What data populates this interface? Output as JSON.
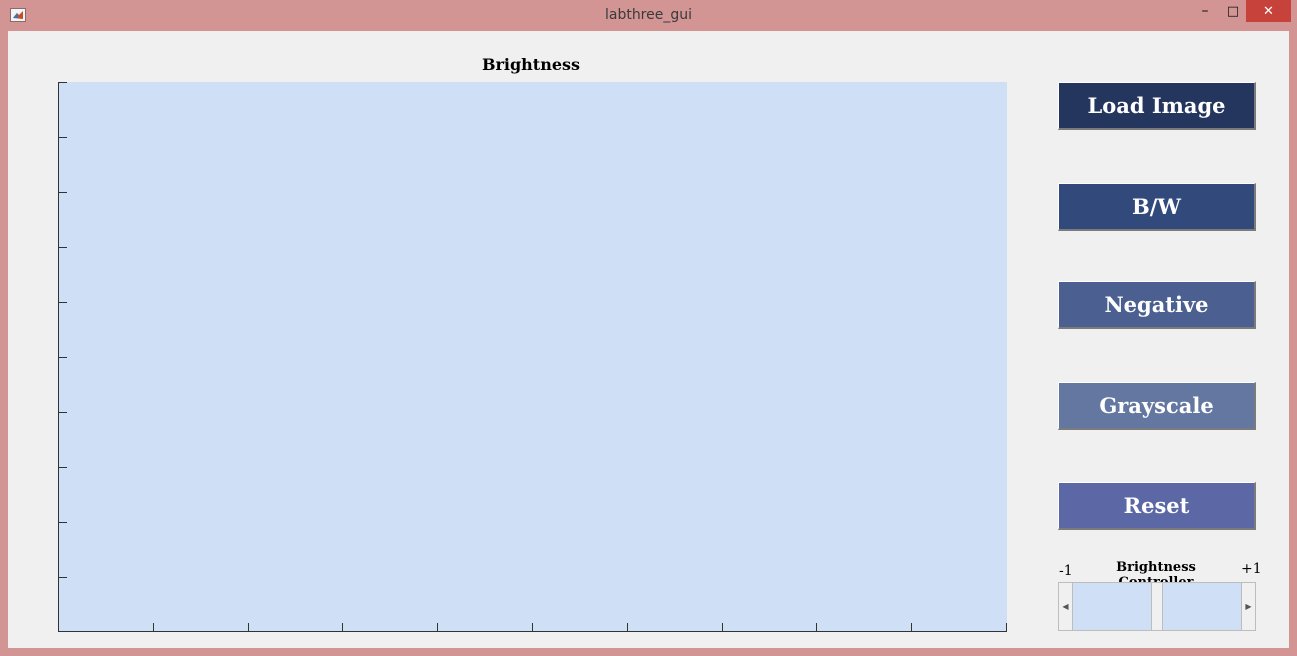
{
  "window": {
    "title": "labthree_gui",
    "controls": {
      "minimize": "–",
      "maximize": "□",
      "close": "✕"
    }
  },
  "axes": {
    "title": "Brightness"
  },
  "buttons": [
    {
      "label": "Load Image",
      "color": "#24365e"
    },
    {
      "label": "B/W",
      "color": "#32497c"
    },
    {
      "label": "Negative",
      "color": "#4b6090"
    },
    {
      "label": "Grayscale",
      "color": "#6377a1"
    },
    {
      "label": "Reset",
      "color": "#5b68a5"
    }
  ],
  "slider": {
    "label": "Brightness Controller",
    "min_label": "-1",
    "max_label": "+1",
    "value": 0
  },
  "colors": {
    "axes_background": "#cfe0f6",
    "panel_background": "#f0f0f0",
    "window_frame": "#d29594"
  }
}
